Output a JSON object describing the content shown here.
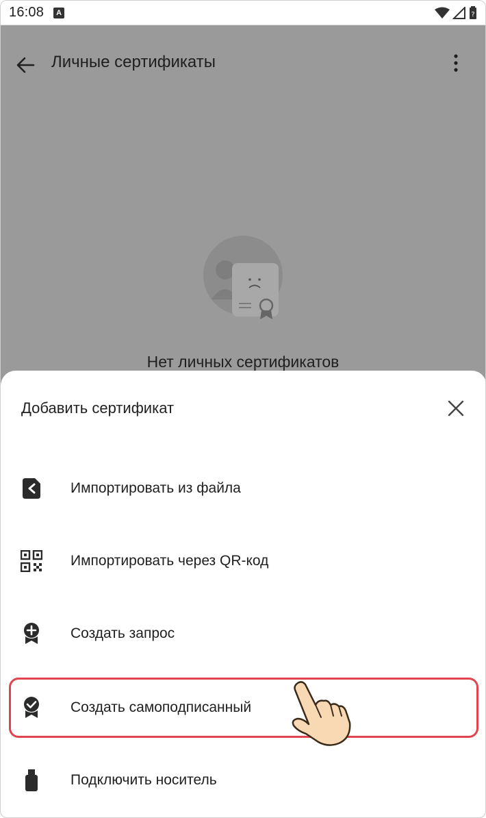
{
  "status_bar": {
    "time": "16:08",
    "badge": "A",
    "icons": [
      "wifi-icon",
      "signal-icon",
      "battery-icon"
    ]
  },
  "app": {
    "title": "Личные сертификаты",
    "empty_text": "Нет личных сертификатов"
  },
  "sheet": {
    "title": "Добавить сертификат",
    "items": [
      {
        "label": "Импортировать из файла",
        "icon": "file-import-icon"
      },
      {
        "label": "Импортировать через QR-код",
        "icon": "qr-code-icon"
      },
      {
        "label": "Создать запрос",
        "icon": "certificate-add-icon"
      },
      {
        "label": "Создать самоподписанный",
        "icon": "certificate-check-icon"
      },
      {
        "label": "Подключить носитель",
        "icon": "usb-token-icon"
      }
    ]
  },
  "colors": {
    "overlay": "#9a9a9a",
    "highlight": "#e0444e",
    "text": "#1f1f1f"
  }
}
